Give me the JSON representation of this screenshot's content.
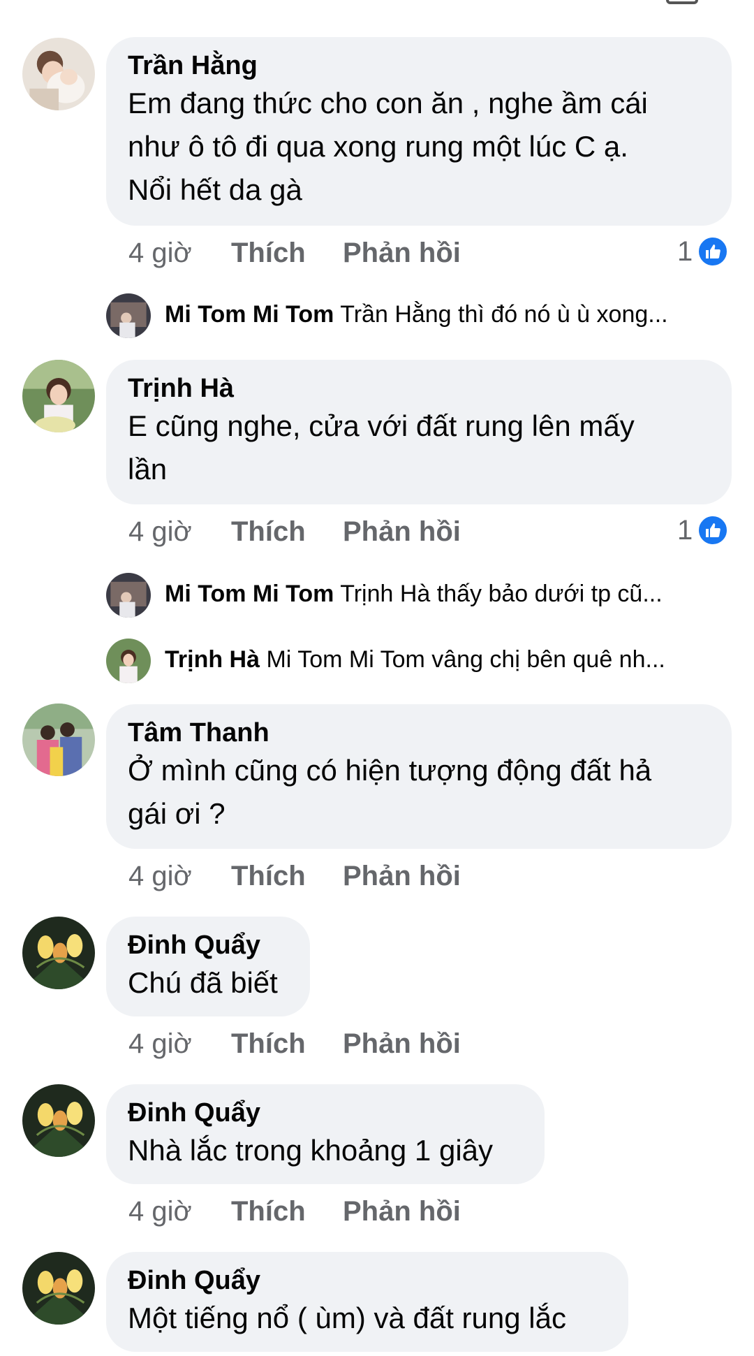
{
  "colors": {
    "bubble": "#f0f2f5",
    "meta": "#65676b",
    "like_blue": "#1877f2"
  },
  "icons": {
    "reaction": "like-thumb-icon"
  },
  "comments": [
    {
      "author": "Trần Hằng",
      "lines": [
        "Em đang thức cho con ăn , nghe ầm cái",
        "như ô tô đi qua xong rung một lúc C ạ.",
        "Nổi hết da gà"
      ],
      "time": "4 giờ",
      "like": "Thích",
      "reply": "Phản hồi",
      "reactions": "1",
      "replies": [
        {
          "author": "Mi Tom Mi Tom",
          "text": "Trần Hằng thì đó nó ù ù xong..."
        }
      ]
    },
    {
      "author": "Trịnh Hà",
      "lines": [
        "E cũng nghe, cửa với đất rung lên mấy",
        "lần"
      ],
      "time": "4 giờ",
      "like": "Thích",
      "reply": "Phản hồi",
      "reactions": "1",
      "replies": [
        {
          "author": "Mi Tom Mi Tom",
          "text": "Trịnh Hà thấy bảo dưới tp cũ..."
        },
        {
          "author": "Trịnh Hà",
          "text": "Mi Tom Mi Tom vâng chị bên quê nh..."
        }
      ]
    },
    {
      "author": "Tâm Thanh",
      "lines": [
        "Ở mình cũng có hiện tượng động đất hả",
        "gái ơi ?"
      ],
      "time": "4 giờ",
      "like": "Thích",
      "reply": "Phản hồi"
    },
    {
      "author": "Đinh Quẩy",
      "lines": [
        "Chú đã biết"
      ],
      "time": "4 giờ",
      "like": "Thích",
      "reply": "Phản hồi"
    },
    {
      "author": "Đinh Quẩy",
      "lines": [
        "Nhà lắc trong khoảng 1 giây"
      ],
      "time": "4 giờ",
      "like": "Thích",
      "reply": "Phản hồi"
    },
    {
      "author": "Đinh Quẩy",
      "lines": [
        "Một tiếng nổ ( ùm) và đất rung lắc"
      ]
    }
  ]
}
